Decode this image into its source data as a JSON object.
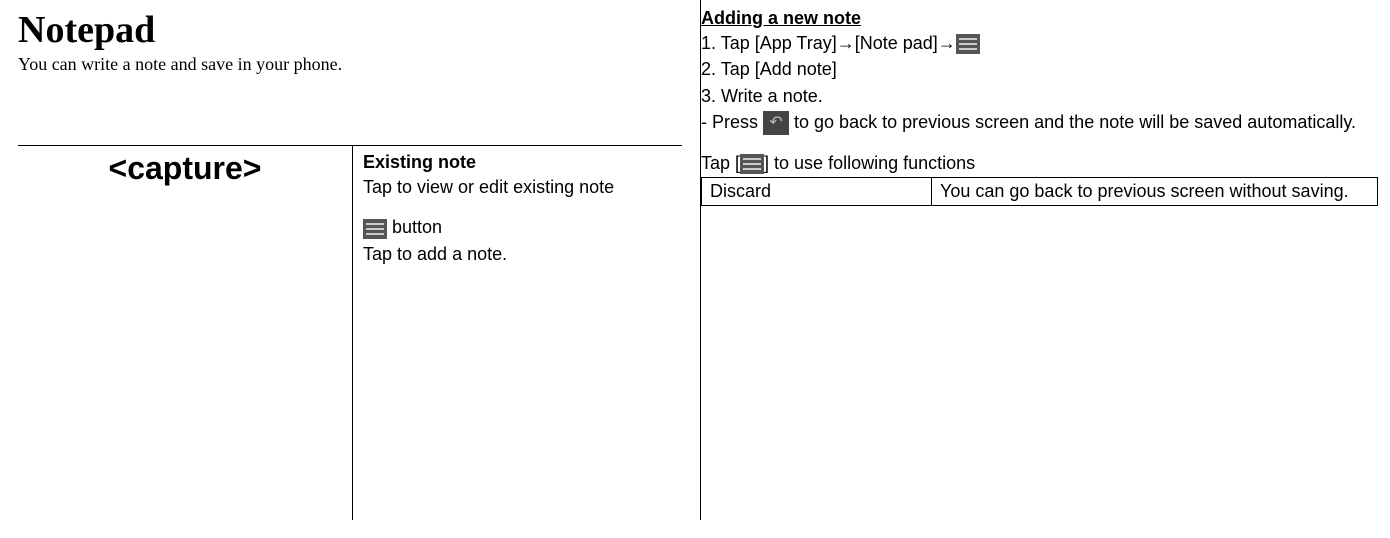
{
  "left": {
    "title": "Notepad",
    "subtitle": "You can write a note and save in your phone.",
    "capture": "<capture>",
    "existing_heading": "Existing note",
    "existing_desc": "Tap to view or edit existing note",
    "button_label": " button",
    "button_desc": "Tap to add a note."
  },
  "right": {
    "heading": "Adding a new note",
    "step1_a": "1. Tap [App Tray]→[Note pad]→",
    "step2": "2. Tap [Add note]",
    "step3": "3. Write a note.",
    "press_a": "- Press ",
    "press_b": " to go back to previous screen and the note will be saved automatically.",
    "tap_a": "Tap [",
    "tap_b": "] to use following functions",
    "table": {
      "r1c1": "Discard",
      "r1c2": "You can go back to previous screen without saving."
    }
  }
}
